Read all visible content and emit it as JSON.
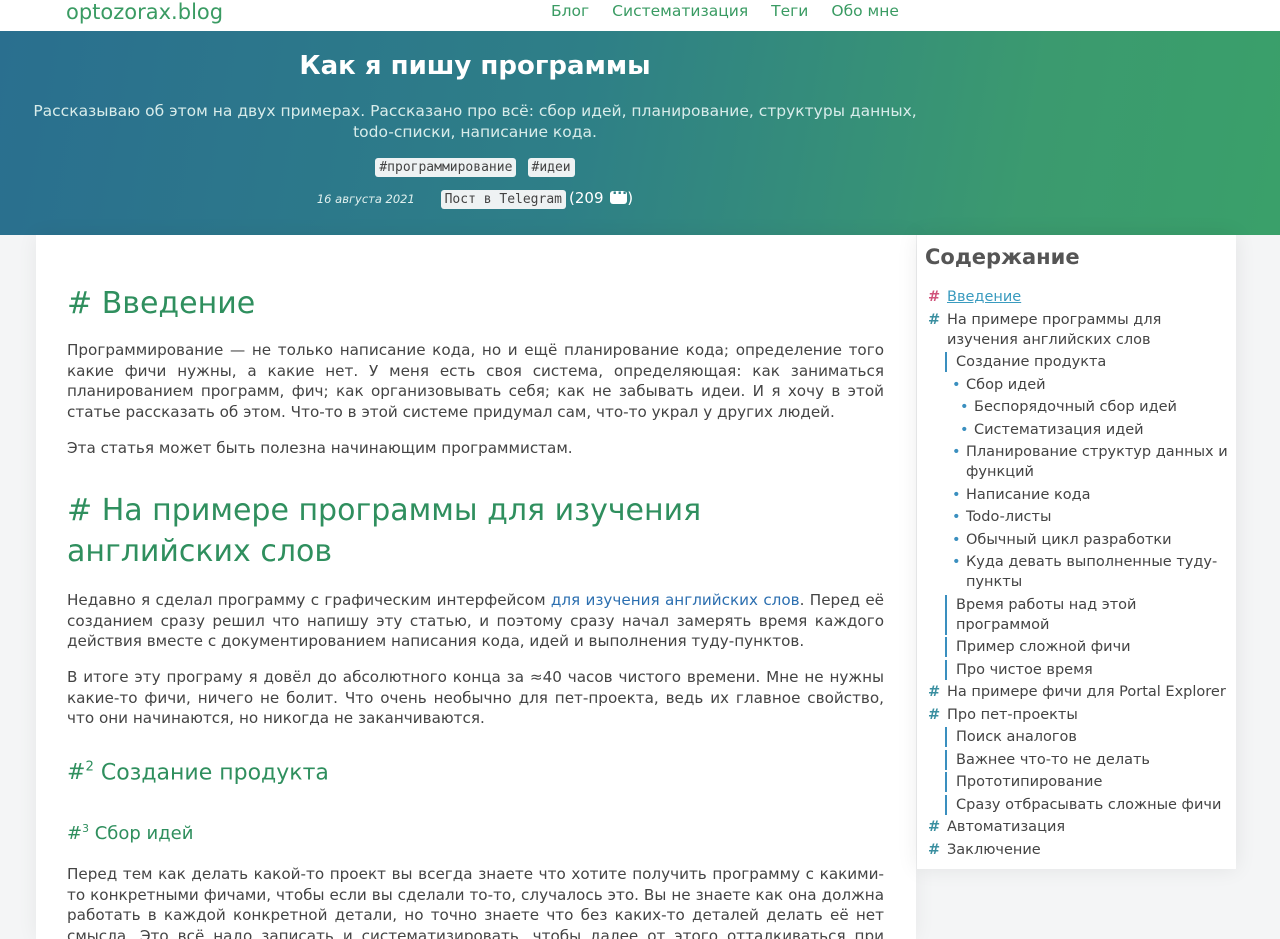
{
  "site": {
    "brand": "optozorax.blog"
  },
  "nav": {
    "items": [
      "Блог",
      "Систематизация",
      "Теги",
      "Обо мне"
    ]
  },
  "hero": {
    "title": "Как я пишу программы",
    "subtitle": "Рассказываю об этом на двух примерах. Рассказано про всё: сбор идей, планирование, структуры данных, todo-списки, написание кода.",
    "tags": [
      "#программирование",
      "#идеи"
    ],
    "date": "16 августа 2021",
    "telegram": "Пост в Telegram",
    "comments_prefix": "(209",
    "comments_suffix": ")"
  },
  "article": {
    "intro_h": "Введение",
    "intro_p1": "Программирование — не только написание кода, но и ещё планирование кода; определение того какие фичи нужны, а какие нет. У меня есть своя система, определяющая: как заниматься планированием программ, фич; как организовывать себя; как не забывать идеи. И я хочу в этой статье рассказать об этом. Что-то в этой системе придумал сам, что-то украл у других людей.",
    "intro_p2": "Эта статья может быть полезна начинающим программистам.",
    "eng_h": "На примере программы для изучения английских слов",
    "eng_p1_a": "Недавно я сделал программу с графическим интерфейсом ",
    "eng_p1_link": "для изучения английских слов",
    "eng_p1_b": ". Перед её созданием сразу решил что напишу эту статью, и поэтому сразу начал замерять время каждого действия вместе с документированием написания кода, идей и выполнения туду-пунктов.",
    "eng_p2": "В итоге эту програму я довёл до абсолютного конца за ≈40 часов чистого времени. Мне не нужны какие-то фичи, ничего не болит. Что очень необычно для пет-проекта, ведь их главное свойство, что они начинаются, но никогда не заканчиваются.",
    "prod_h": "Создание продукта",
    "prod_level": "2",
    "ideas_h": "Сбор идей",
    "ideas_level": "3",
    "ideas_p1": "Перед тем как делать какой-то проект вы всегда знаете что хотите получить программу с какими-то конкретными фичами, чтобы если вы сделали то-то, случалось это. Вы не знаете как она должна работать в каждой конкретной детали, но точно знаете что без каких-то деталей делать её нет смысла. Это всё надо записать и систематизировать, чтобы далее от этого отталкиваться при написании кода."
  },
  "toc": {
    "title": "Содержание",
    "items": [
      {
        "label": "Введение",
        "level": 1,
        "active": true
      },
      {
        "label": "На примере программы для изучения английских слов",
        "level": 1
      },
      {
        "label": "Создание продукта",
        "level": 2
      },
      {
        "label": "Сбор идей",
        "level": 3
      },
      {
        "label": "Беспорядочный сбор идей",
        "level": 4
      },
      {
        "label": "Систематизация идей",
        "level": 4
      },
      {
        "label": "Планирование структур данных и функций",
        "level": 3
      },
      {
        "label": "Написание кода",
        "level": 3
      },
      {
        "label": "Todo-листы",
        "level": 3
      },
      {
        "label": "Обычный цикл разработки",
        "level": 3
      },
      {
        "label": "Куда девать выполненные туду-пункты",
        "level": 3
      },
      {
        "label": "Время работы над этой программой",
        "level": 2
      },
      {
        "label": "Пример сложной фичи",
        "level": 2
      },
      {
        "label": "Про чистое время",
        "level": 2
      },
      {
        "label": "На примере фичи для Portal Explorer",
        "level": 1
      },
      {
        "label": "Про пет-проекты",
        "level": 1
      },
      {
        "label": "Поиск аналогов",
        "level": 2
      },
      {
        "label": "Важнее что-то не делать",
        "level": 2
      },
      {
        "label": "Прототипирование",
        "level": 2
      },
      {
        "label": "Сразу отбрасывать сложные фичи",
        "level": 2
      },
      {
        "label": "Автоматизация",
        "level": 1
      },
      {
        "label": "Заключение",
        "level": 1
      }
    ]
  },
  "colors": {
    "accent": "#2f8f5e",
    "link": "#2c6fb0",
    "toc_bullet": "#3a8fbf"
  }
}
